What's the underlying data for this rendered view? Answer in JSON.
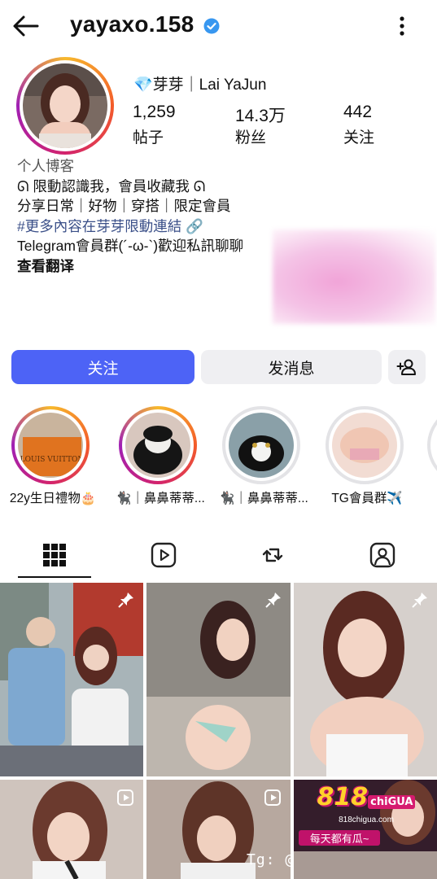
{
  "header": {
    "username": "yayaxo.158",
    "back_icon": "arrow-left-icon",
    "more_icon": "more-vertical-icon"
  },
  "profile": {
    "display_name": "💎芽芽｜Lai YaJun",
    "stats": [
      {
        "value": "1,259",
        "label": "帖子"
      },
      {
        "value": "14.3万",
        "label": "粉丝"
      },
      {
        "value": "442",
        "label": "关注"
      }
    ],
    "bio": {
      "category": "个人博客",
      "line1": "ᘏ 限動認識我，會員收藏我 ᘏ",
      "line2": "分享日常｜好物｜穿搭｜限定會員",
      "hashtag": "#更多內容在芽芽限動連結 🔗",
      "line4": "Telegram會員群(´-ω-`)歡迎私訊聊聊",
      "translate": "查看翻译"
    }
  },
  "actions": {
    "follow": "关注",
    "message": "发消息"
  },
  "highlights": [
    {
      "label": "22y生日禮物🎂"
    },
    {
      "label": "🐈‍⬛｜鼻鼻蒂蒂..."
    },
    {
      "label": "🐈‍⬛｜鼻鼻蒂蒂..."
    },
    {
      "label": "TG會員群✈️"
    }
  ],
  "tabs": [
    "grid-icon",
    "reels-icon",
    "reposts-icon",
    "tagged-icon"
  ],
  "ad": {
    "brand_num": "818",
    "brand_text": "chiGUA",
    "site": "818chigua.com",
    "tagline": "每天都有瓜~"
  },
  "watermark": "Tg: @"
}
